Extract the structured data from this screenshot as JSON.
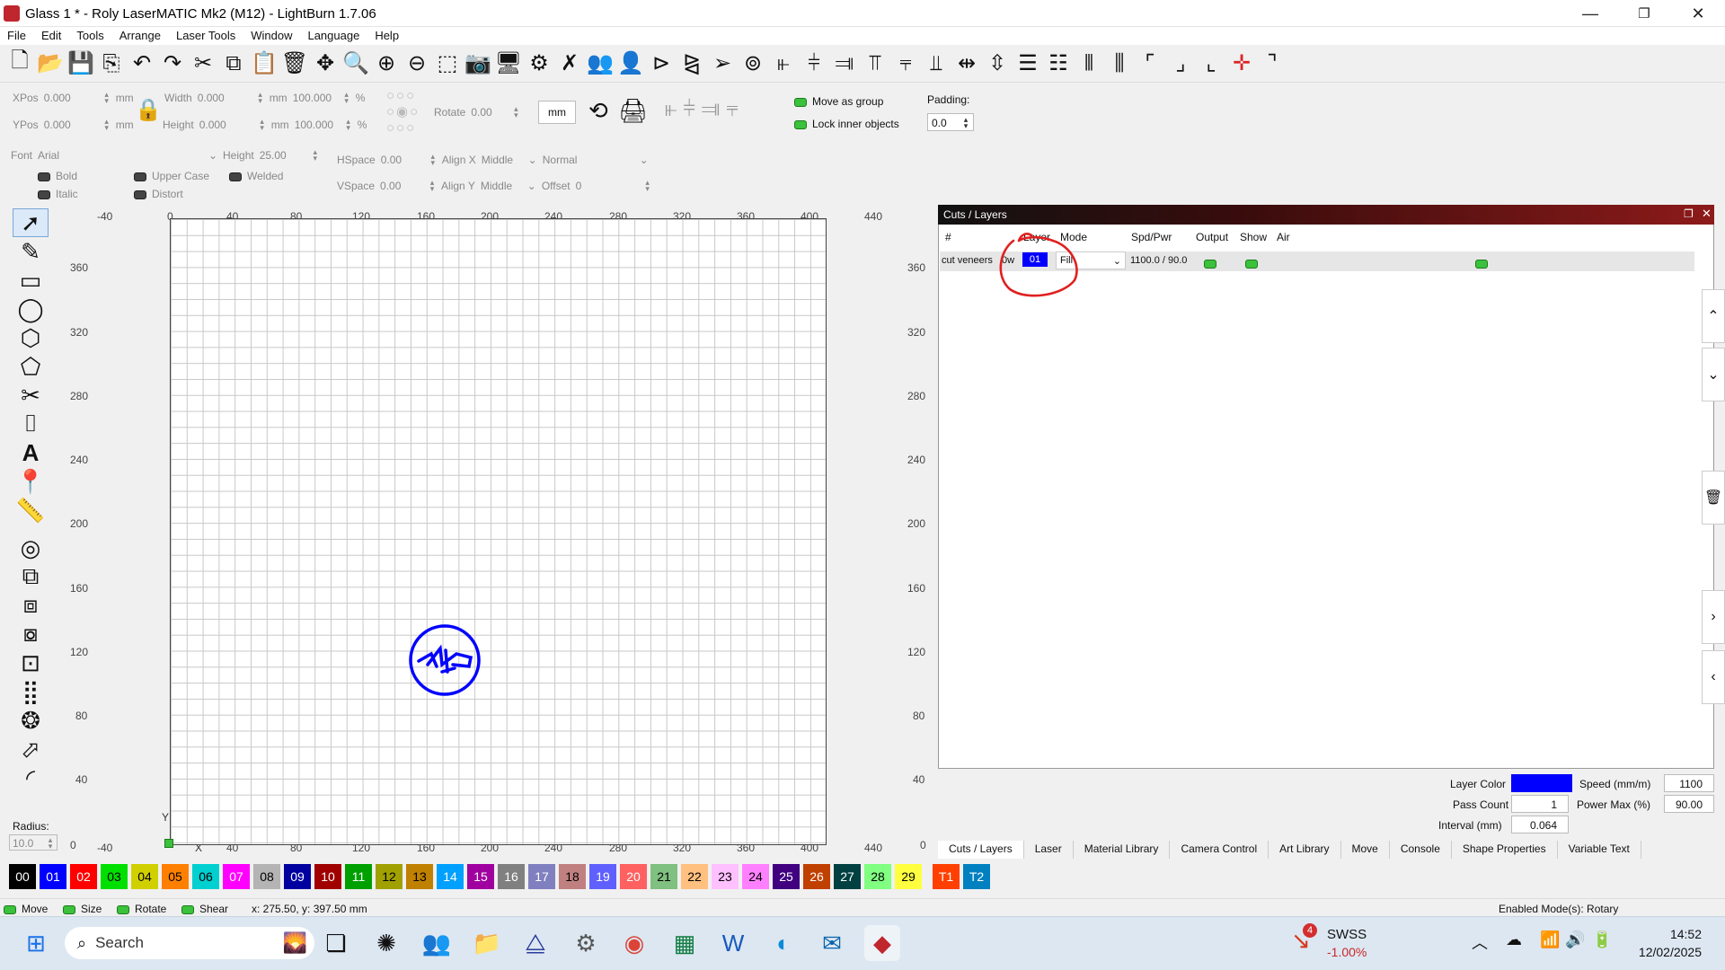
{
  "window": {
    "title": "Glass 1 * - Roly LaserMATIC Mk2 (M12) - LightBurn 1.7.06",
    "minimize": "—",
    "maximize": "❐",
    "close": "✕"
  },
  "menu": [
    "File",
    "Edit",
    "Tools",
    "Arrange",
    "Laser Tools",
    "Window",
    "Language",
    "Help"
  ],
  "geometry": {
    "xpos_label": "XPos",
    "xpos": "0.000",
    "ypos_label": "YPos",
    "ypos": "0.000",
    "width_label": "Width",
    "width": "0.000",
    "height_label": "Height",
    "height": "0.000",
    "unit": "mm",
    "pct_w": "100.000",
    "pct_h": "100.000",
    "pct": "%",
    "rotate_label": "Rotate",
    "rotate": "0.00",
    "mm_button": "mm",
    "move_as_group": "Move as group",
    "lock_inner": "Lock inner objects",
    "padding_label": "Padding:",
    "padding": "0.0"
  },
  "text_tools": {
    "font_label": "Font",
    "font": "Arial",
    "height_label": "Height",
    "height": "25.00",
    "bold": "Bold",
    "upper_case": "Upper Case",
    "welded": "Welded",
    "italic": "Italic",
    "distort": "Distort",
    "hspace_label": "HSpace",
    "hspace": "0.00",
    "vspace_label": "VSpace",
    "vspace": "0.00",
    "alignx_label": "Align X",
    "alignx": "Middle",
    "aligny_label": "Align Y",
    "aligny": "Middle",
    "normal": "Normal",
    "offset_label": "Offset",
    "offset": "0"
  },
  "ruler": {
    "top": [
      "-40",
      "0",
      "40",
      "80",
      "120",
      "160",
      "200",
      "240",
      "280",
      "320",
      "360",
      "400",
      "440"
    ],
    "bottom": [
      "-40",
      "0",
      "40",
      "80",
      "120",
      "160",
      "200",
      "240",
      "280",
      "320",
      "360",
      "400",
      "440"
    ],
    "left": [
      "360",
      "320",
      "280",
      "240",
      "200",
      "160",
      "120",
      "80",
      "40",
      "0"
    ],
    "right": [
      "360",
      "320",
      "280",
      "240",
      "200",
      "160",
      "120",
      "80",
      "40",
      "0"
    ],
    "axis_x": "X",
    "axis_y": "Y"
  },
  "radius": {
    "label": "Radius:",
    "value": "10.0"
  },
  "cuts_panel": {
    "title": "Cuts / Layers",
    "columns": [
      "#",
      "Layer",
      "Mode",
      "Spd/Pwr",
      "Output",
      "Show",
      "Air"
    ],
    "row": {
      "name": "cut veneers",
      "power": "0w",
      "layer": "01",
      "mode": "Fill",
      "spdpwr": "1100.0 / 90.0"
    },
    "layer_color_label": "Layer Color",
    "layer_color": "#0000ff",
    "speed_label": "Speed (mm/m)",
    "speed": "1100",
    "pass_label": "Pass Count",
    "pass": "1",
    "power_label": "Power Max (%)",
    "power": "90.00",
    "interval_label": "Interval (mm)",
    "interval": "0.064"
  },
  "bottom_tabs": [
    "Cuts / Layers",
    "Laser",
    "Material Library",
    "Camera Control",
    "Art Library",
    "Move",
    "Console",
    "Shape Properties",
    "Variable Text"
  ],
  "palette": [
    {
      "label": "00",
      "color": "#000000",
      "fg": "#ffffff"
    },
    {
      "label": "01",
      "color": "#0000ff",
      "fg": "#ffffff"
    },
    {
      "label": "02",
      "color": "#ff0000",
      "fg": "#ffffff"
    },
    {
      "label": "03",
      "color": "#00e000",
      "fg": "#000000"
    },
    {
      "label": "04",
      "color": "#d0d000",
      "fg": "#000000"
    },
    {
      "label": "05",
      "color": "#ff8000",
      "fg": "#000000"
    },
    {
      "label": "06",
      "color": "#00d0d0",
      "fg": "#000000"
    },
    {
      "label": "07",
      "color": "#ff00ff",
      "fg": "#ffffff"
    },
    {
      "label": "08",
      "color": "#b4b4b4",
      "fg": "#000000"
    },
    {
      "label": "09",
      "color": "#0000a0",
      "fg": "#ffffff"
    },
    {
      "label": "10",
      "color": "#a00000",
      "fg": "#ffffff"
    },
    {
      "label": "11",
      "color": "#00a000",
      "fg": "#ffffff"
    },
    {
      "label": "12",
      "color": "#a0a000",
      "fg": "#000000"
    },
    {
      "label": "13",
      "color": "#c08000",
      "fg": "#000000"
    },
    {
      "label": "14",
      "color": "#00a0ff",
      "fg": "#ffffff"
    },
    {
      "label": "15",
      "color": "#a000a0",
      "fg": "#ffffff"
    },
    {
      "label": "16",
      "color": "#808080",
      "fg": "#ffffff"
    },
    {
      "label": "17",
      "color": "#8080c0",
      "fg": "#ffffff"
    },
    {
      "label": "18",
      "color": "#c08080",
      "fg": "#000000"
    },
    {
      "label": "19",
      "color": "#6060ff",
      "fg": "#ffffff"
    },
    {
      "label": "20",
      "color": "#ff6060",
      "fg": "#ffffff"
    },
    {
      "label": "21",
      "color": "#80c080",
      "fg": "#000000"
    },
    {
      "label": "22",
      "color": "#ffc080",
      "fg": "#000000"
    },
    {
      "label": "23",
      "color": "#ffc0ff",
      "fg": "#000000"
    },
    {
      "label": "24",
      "color": "#ff80ff",
      "fg": "#000000"
    },
    {
      "label": "25",
      "color": "#400080",
      "fg": "#ffffff"
    },
    {
      "label": "26",
      "color": "#c04000",
      "fg": "#ffffff"
    },
    {
      "label": "27",
      "color": "#004040",
      "fg": "#ffffff"
    },
    {
      "label": "28",
      "color": "#80ff80",
      "fg": "#000000"
    },
    {
      "label": "29",
      "color": "#ffff40",
      "fg": "#000000"
    },
    {
      "label": "T1",
      "color": "#ff4000",
      "fg": "#ffffff"
    },
    {
      "label": "T2",
      "color": "#0080c0",
      "fg": "#ffffff"
    }
  ],
  "status": {
    "move": "Move",
    "size": "Size",
    "rotate": "Rotate",
    "shear": "Shear",
    "coords": "x: 275.50, y: 397.50 mm",
    "modes": "Enabled Mode(s): Rotary"
  },
  "taskbar": {
    "search": "Search",
    "stock_name": "SWSS",
    "stock_change": "-1.00%",
    "badge": "4",
    "time": "14:52",
    "date": "12/02/2025"
  }
}
